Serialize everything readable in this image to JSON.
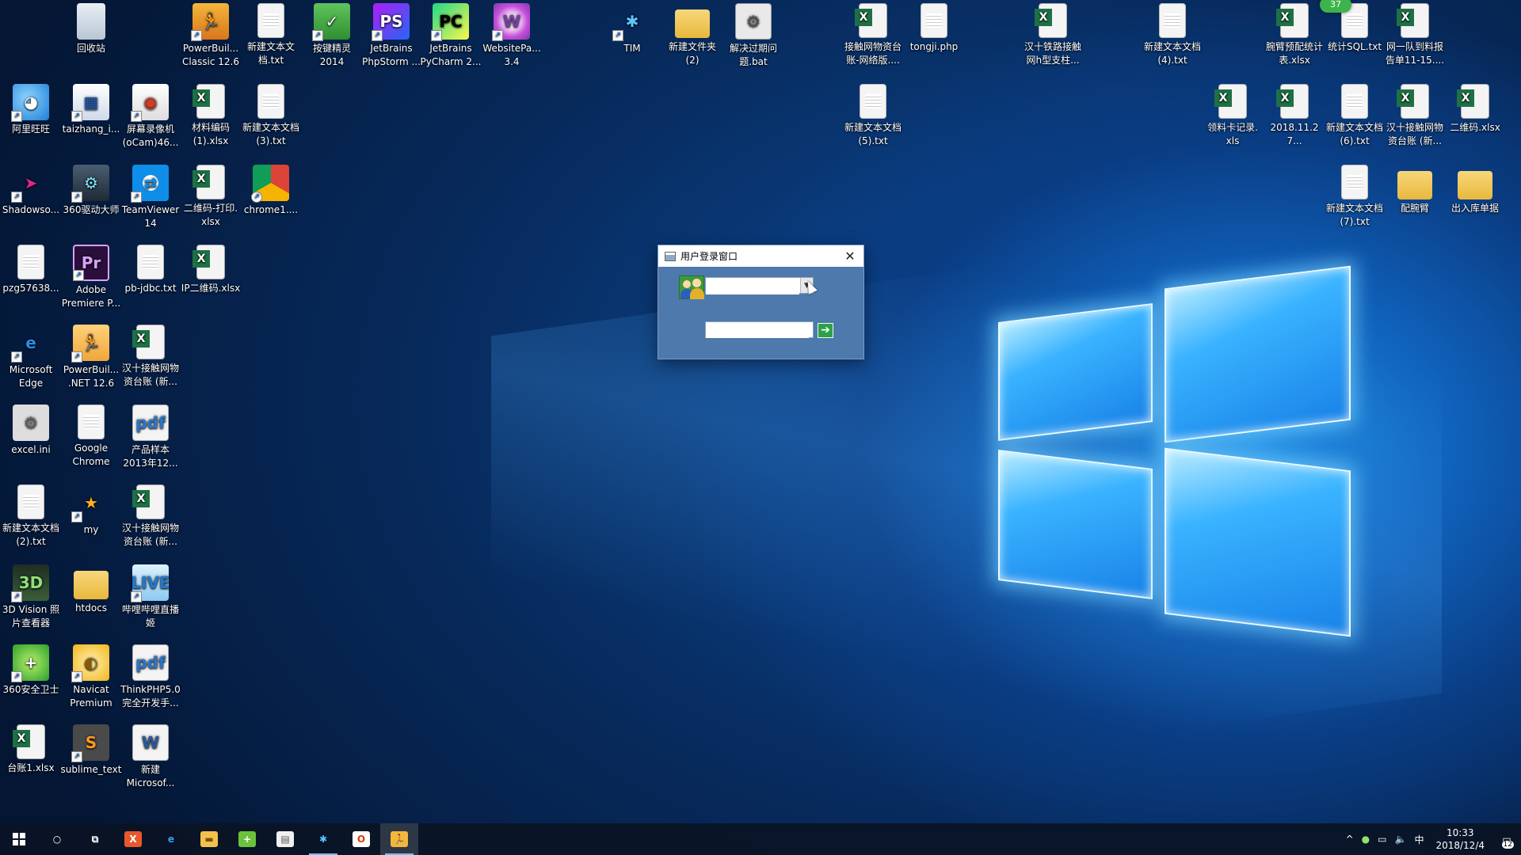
{
  "desktop": {
    "notification_badge": "37",
    "icons": [
      {
        "label": "回收站",
        "glyph": "",
        "kind": "recycle",
        "icon": "recycle-bin-icon"
      },
      {
        "label": "PowerBuil...\nClassic 12.6",
        "glyph": "🏃",
        "kind": "run",
        "icon": "powerbuilder-icon"
      },
      {
        "label": "新建文本文\n档.txt",
        "glyph": "",
        "kind": "file",
        "icon": "text-file-icon"
      },
      {
        "label": "按键精灵\n2014",
        "glyph": "✓",
        "kind": "green",
        "icon": "anjian-jingling-icon"
      },
      {
        "label": "JetBrains\nPhpStorm ...",
        "glyph": "PS",
        "kind": "ps",
        "icon": "phpstorm-icon"
      },
      {
        "label": "JetBrains\nPyCharm 2...",
        "glyph": "PC",
        "kind": "pc",
        "icon": "pycharm-icon"
      },
      {
        "label": "WebsitePa...\n3.4",
        "glyph": "W",
        "kind": "web",
        "icon": "websitepainter-icon"
      },
      {
        "label": "TIM",
        "glyph": "✱",
        "kind": "tim",
        "icon": "tim-icon"
      },
      {
        "label": "新建文件夹\n(2)",
        "glyph": "",
        "kind": "folder",
        "icon": "folder-icon"
      },
      {
        "label": "解决过期问\n题.bat",
        "glyph": "⚙",
        "kind": "bat",
        "icon": "bat-file-icon"
      },
      {
        "label": "接触网物资台\n账-网络版....",
        "glyph": "",
        "kind": "excel",
        "icon": "excel-file-icon"
      },
      {
        "label": "tongji.php",
        "glyph": "",
        "kind": "file",
        "icon": "php-file-icon"
      },
      {
        "label": "汉十铁路接触\n网h型支柱...",
        "glyph": "",
        "kind": "excel",
        "icon": "excel-file-icon"
      },
      {
        "label": "新建文本文档\n(4).txt",
        "glyph": "",
        "kind": "file",
        "icon": "text-file-icon"
      },
      {
        "label": "腕臂预配统计\n表.xlsx",
        "glyph": "",
        "kind": "excel",
        "icon": "excel-file-icon"
      },
      {
        "label": "统计SQL.txt",
        "glyph": "",
        "kind": "file",
        "icon": "text-file-icon"
      },
      {
        "label": "网一队到料报\n告单11-15....",
        "glyph": "",
        "kind": "excel",
        "icon": "excel-file-icon"
      },
      {
        "label": "阿里旺旺",
        "glyph": "◕",
        "kind": "ali",
        "icon": "aliwangwang-icon"
      },
      {
        "label": "taizhang_i...",
        "glyph": "▦",
        "kind": "tai",
        "icon": "taizhang-icon"
      },
      {
        "label": "屏幕录像机\n(oCam)46...",
        "glyph": "◉",
        "kind": "ocam",
        "icon": "ocam-icon"
      },
      {
        "label": "材料编码\n(1).xlsx",
        "glyph": "",
        "kind": "excel",
        "icon": "excel-file-icon"
      },
      {
        "label": "新建文本文档\n(3).txt",
        "glyph": "",
        "kind": "file",
        "icon": "text-file-icon"
      },
      {
        "label": "新建文本文档\n(5).txt",
        "glyph": "",
        "kind": "file",
        "icon": "text-file-icon"
      },
      {
        "label": "领料卡记录.\nxls",
        "glyph": "",
        "kind": "excel",
        "icon": "excel-file-icon"
      },
      {
        "label": "2018.11.27...",
        "glyph": "",
        "kind": "excel",
        "icon": "excel-file-icon"
      },
      {
        "label": "新建文本文档\n(6).txt",
        "glyph": "",
        "kind": "file",
        "icon": "text-file-icon"
      },
      {
        "label": "汉十接触网物\n资台账 (新...",
        "glyph": "",
        "kind": "excel",
        "icon": "excel-file-icon"
      },
      {
        "label": "二维码.xlsx",
        "glyph": "",
        "kind": "excel",
        "icon": "excel-file-icon"
      },
      {
        "label": "Shadowso...",
        "glyph": "➤",
        "kind": "shadow",
        "icon": "shadowsocks-icon"
      },
      {
        "label": "360驱动大师",
        "glyph": "⚙",
        "kind": "360d",
        "icon": "driver-master-icon"
      },
      {
        "label": "TeamViewer\n14",
        "glyph": "⇄",
        "kind": "tv",
        "icon": "teamviewer-icon"
      },
      {
        "label": "二维码-打印.\nxlsx",
        "glyph": "",
        "kind": "excel",
        "icon": "excel-file-icon"
      },
      {
        "label": "chrome1....",
        "glyph": "",
        "kind": "chrome",
        "icon": "chrome-icon"
      },
      {
        "label": "新建文本文档\n(7).txt",
        "glyph": "",
        "kind": "file",
        "icon": "text-file-icon"
      },
      {
        "label": "配腕臂",
        "glyph": "",
        "kind": "folder",
        "icon": "folder-icon"
      },
      {
        "label": "出入库单据",
        "glyph": "",
        "kind": "folder",
        "icon": "folder-icon"
      },
      {
        "label": "pzg57638...",
        "glyph": "",
        "kind": "file",
        "icon": "image-file-icon"
      },
      {
        "label": "Adobe\nPremiere P...",
        "glyph": "Pr",
        "kind": "pr",
        "icon": "premiere-icon"
      },
      {
        "label": "pb-jdbc.txt",
        "glyph": "",
        "kind": "file",
        "icon": "text-file-icon"
      },
      {
        "label": "IP二维码.xlsx",
        "glyph": "",
        "kind": "excel",
        "icon": "excel-file-icon"
      },
      {
        "label": "Microsoft\nEdge",
        "glyph": "e",
        "kind": "edge",
        "icon": "edge-icon"
      },
      {
        "label": "PowerBuil...\n.NET 12.6",
        "glyph": "🏃",
        "kind": "pbnet",
        "icon": "powerbuilder-net-icon"
      },
      {
        "label": "汉十接触网物\n资台账 (新...",
        "glyph": "",
        "kind": "excel",
        "icon": "excel-file-icon"
      },
      {
        "label": "excel.ini",
        "glyph": "⚙",
        "kind": "ini",
        "icon": "ini-file-icon"
      },
      {
        "label": "Google\nChrome",
        "glyph": "",
        "kind": "file",
        "icon": "google-chrome-file-icon"
      },
      {
        "label": "产品样本\n2013年12...",
        "glyph": "pdf",
        "kind": "pdf",
        "icon": "pdf-file-icon"
      },
      {
        "label": "新建文本文档\n(2).txt",
        "glyph": "",
        "kind": "file",
        "icon": "text-file-icon"
      },
      {
        "label": "my",
        "glyph": "★",
        "kind": "my",
        "icon": "my-app-icon"
      },
      {
        "label": "汉十接触网物\n资台账 (新...",
        "glyph": "",
        "kind": "excel",
        "icon": "excel-file-icon"
      },
      {
        "label": "3D Vision 照\n片查看器",
        "glyph": "3D",
        "kind": "3d",
        "icon": "3d-vision-icon"
      },
      {
        "label": "htdocs",
        "glyph": "",
        "kind": "folder",
        "icon": "folder-icon"
      },
      {
        "label": "哔哩哔哩直播\n姬",
        "glyph": "LIVE",
        "kind": "live",
        "icon": "bilibili-live-icon"
      },
      {
        "label": "360安全卫士",
        "glyph": "+",
        "kind": "360",
        "icon": "360-security-icon"
      },
      {
        "label": "Navicat\nPremium",
        "glyph": "◐",
        "kind": "navicat",
        "icon": "navicat-icon"
      },
      {
        "label": "ThinkPHP5.0\n完全开发手...",
        "glyph": "pdf",
        "kind": "pdf",
        "icon": "pdf-file-icon"
      },
      {
        "label": "台账1.xlsx",
        "glyph": "",
        "kind": "excel",
        "icon": "excel-file-icon"
      },
      {
        "label": "sublime_text",
        "glyph": "S",
        "kind": "sublime",
        "icon": "sublime-text-icon"
      },
      {
        "label": "新建\nMicrosof...",
        "glyph": "W",
        "kind": "word",
        "icon": "word-file-icon"
      }
    ]
  },
  "dialog": {
    "title": "用户登录窗口",
    "close_glyph": "✕",
    "username_value": "",
    "password_value": "",
    "login_glyph": "➔"
  },
  "taskbar": {
    "apps": [
      {
        "name": "taskbar-search-button",
        "glyph": "○",
        "bg": "transparent",
        "color": "#ffffff",
        "running": false
      },
      {
        "name": "taskbar-task-view-button",
        "glyph": "⧉",
        "bg": "transparent",
        "color": "#ffffff",
        "running": false
      },
      {
        "name": "taskbar-app-xmind",
        "glyph": "X",
        "bg": "#e8582a",
        "color": "#ffffff",
        "running": false
      },
      {
        "name": "taskbar-app-edge",
        "glyph": "e",
        "bg": "transparent",
        "color": "#3a9cf0",
        "running": false
      },
      {
        "name": "taskbar-app-file-explorer",
        "glyph": "▬",
        "bg": "#f2c14e",
        "color": "#7a5200",
        "running": false
      },
      {
        "name": "taskbar-app-360",
        "glyph": "+",
        "bg": "#6bc13c",
        "color": "#ffffff",
        "running": false
      },
      {
        "name": "taskbar-app-notepad",
        "glyph": "▤",
        "bg": "#f0f0f0",
        "color": "#555555",
        "running": false
      },
      {
        "name": "taskbar-app-tim",
        "glyph": "✱",
        "bg": "transparent",
        "color": "#5cc4ff",
        "running": true
      },
      {
        "name": "taskbar-app-office",
        "glyph": "O",
        "bg": "#ffffff",
        "color": "#d83b01",
        "running": false
      },
      {
        "name": "taskbar-app-powerbuilder",
        "glyph": "🏃",
        "bg": "#f4b63b",
        "color": "#3a2000",
        "running": true,
        "active": true
      }
    ],
    "tray": {
      "chevron": "^",
      "input_method": "中",
      "time": "10:33",
      "date": "2018/12/4",
      "notification_count": "12"
    }
  }
}
